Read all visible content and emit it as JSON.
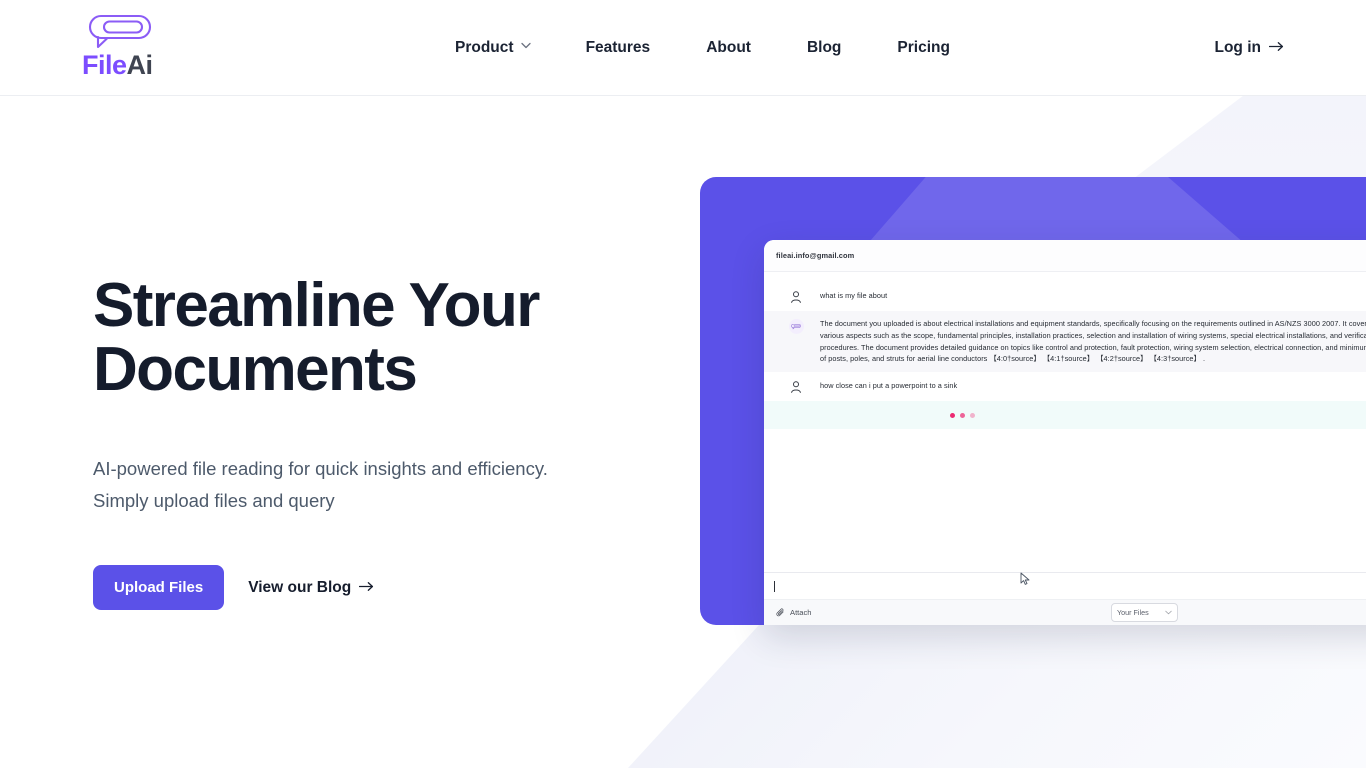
{
  "brand": {
    "name_part1": "File",
    "name_part2": "Ai",
    "logo_icon": "chat-bubble-icon",
    "accent": "#7c4dff",
    "primary": "#5b51e8"
  },
  "header": {
    "nav": [
      {
        "label": "Product",
        "icon": "chevron-down-icon",
        "has_dropdown": true
      },
      {
        "label": "Features",
        "has_dropdown": false
      },
      {
        "label": "About",
        "has_dropdown": false
      },
      {
        "label": "Blog",
        "has_dropdown": false
      },
      {
        "label": "Pricing",
        "has_dropdown": false
      }
    ],
    "login": {
      "label": "Log in",
      "icon": "arrow-right-icon"
    }
  },
  "hero": {
    "heading_line1": "Streamline Your",
    "heading_line2": "Documents",
    "subheading_line1": "AI-powered file reading for quick insights and efficiency.",
    "subheading_line2": "Simply upload files and query",
    "primary_cta": "Upload Files",
    "secondary_cta": "View our Blog",
    "secondary_cta_icon": "arrow-right-icon"
  },
  "mockup": {
    "account_email": "fileai.info@gmail.com",
    "messages": [
      {
        "role": "user",
        "avatar": "user-icon",
        "text": "what is my file about"
      },
      {
        "role": "assistant",
        "avatar": "assistant-bubble-icon",
        "text": "The document you uploaded is about electrical installations and equipment standards, specifically focusing on the requirements outlined in AS/NZS 3000 2007. It covers various aspects such as the scope, fundamental principles, installation practices, selection and installation of wiring systems, special electrical installations, and verification procedures. The document provides detailed guidance on topics like control and protection, fault protection, wiring system selection, electrical connection, and minimum sizes of posts, poles, and struts for aerial line conductors 【4:0†source】 【4:1†source】 【4:2†source】 【4:3†source】 ."
      },
      {
        "role": "user",
        "avatar": "user-icon",
        "text": "how close can i put a powerpoint to a sink"
      },
      {
        "role": "assistant-pending",
        "avatar": "typing-indicator",
        "text": ""
      }
    ],
    "composer": {
      "input_value": "",
      "input_placeholder": "",
      "attach_label": "Attach",
      "attach_icon": "paperclip-icon",
      "files_select_value": "Your Files",
      "files_select_icon": "chevron-down-icon",
      "send_icon": "send-icon",
      "send_button_color": "#7c16e8"
    },
    "typing_dot_color": "#ec2a72"
  }
}
